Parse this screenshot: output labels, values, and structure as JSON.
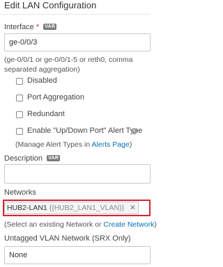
{
  "header": {
    "title": "Edit LAN Configuration"
  },
  "interface": {
    "label": "Interface",
    "required_mark": "*",
    "var_badge": "VAR",
    "value": "ge-0/0/3",
    "hint": "(ge-0/0/1 or ge-0/0/1-5 or reth0, comma separated aggregation)"
  },
  "options": {
    "disabled_label": "Disabled",
    "port_aggregation_label": "Port Aggregation",
    "redundant_label": "Redundant",
    "alert_type_label": "Enable \"Up/Down Port\" Alert Type",
    "manage_prefix": "(Manage Alert Types in ",
    "manage_link": "Alerts Page",
    "manage_suffix": ")"
  },
  "description": {
    "label": "Description",
    "var_badge": "VAR",
    "value": ""
  },
  "networks": {
    "label": "Networks",
    "tag_name": "HUB2-LAN1",
    "tag_var": "{{HUB2_LAN1_VLAN}}",
    "tag_remove": "✕",
    "hint_prefix": "(Select an existing Network or ",
    "hint_link": "Create Network",
    "hint_suffix": ")"
  },
  "untagged": {
    "label": "Untagged VLAN Network (SRX Only)",
    "value": "None"
  },
  "colors": {
    "highlight": "#d22630",
    "link": "#0a6fb8"
  }
}
